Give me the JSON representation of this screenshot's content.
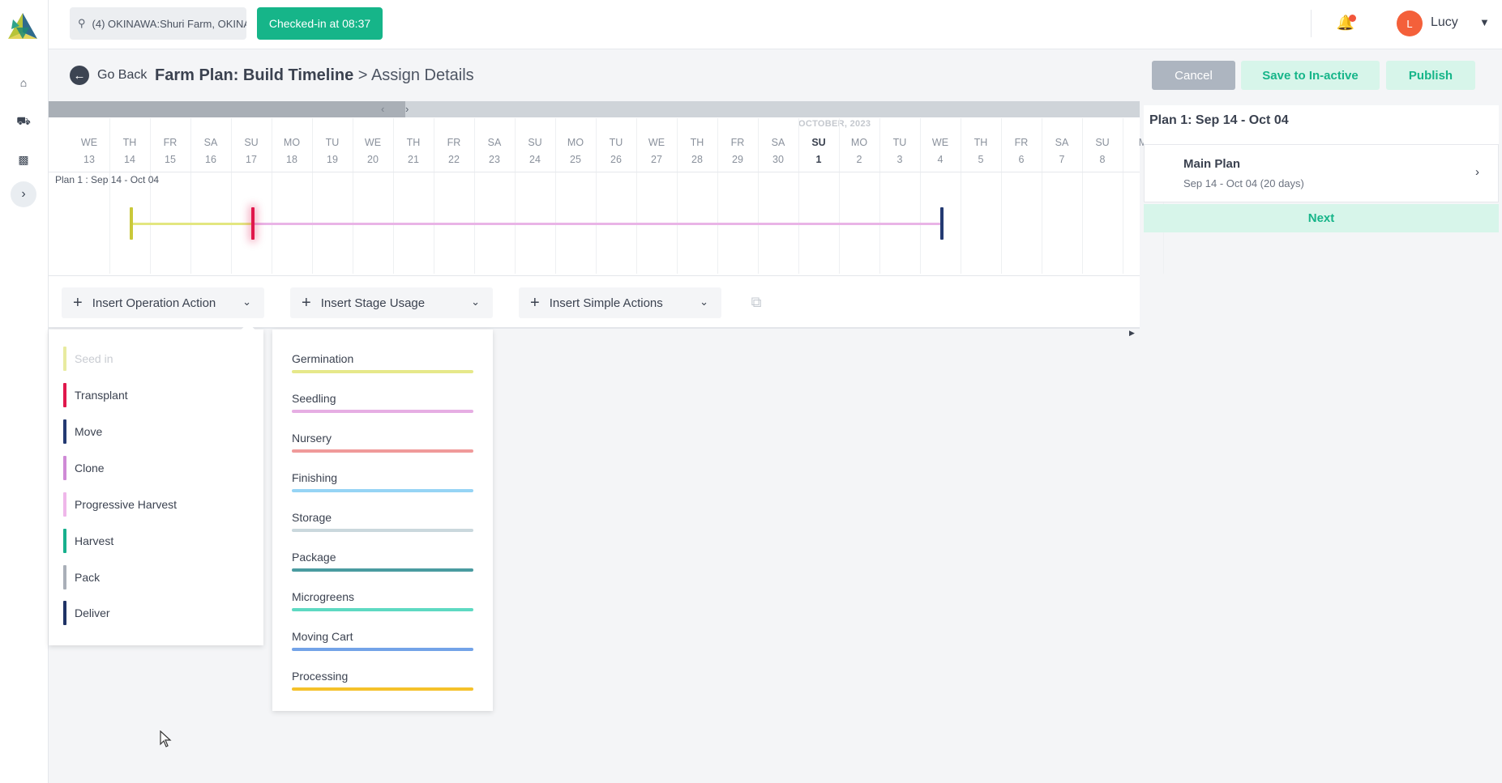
{
  "header": {
    "location": "(4) OKINAWA:Shuri Farm, OKINAWA",
    "checkin": "Checked-in at 08:37",
    "user_initial": "L",
    "user_name": "Lucy"
  },
  "page": {
    "go_back": "Go Back",
    "title": "Farm Plan: Build Timeline",
    "separator": ">",
    "subtitle": "Assign Details",
    "cancel": "Cancel",
    "save_inactive": "Save to In-active",
    "publish": "Publish"
  },
  "timeline": {
    "month": "OCTOBER, 2023",
    "row_label": "Plan 1 : Sep 14 - Oct 04",
    "days": [
      {
        "dow": "WE",
        "num": "13"
      },
      {
        "dow": "TH",
        "num": "14"
      },
      {
        "dow": "FR",
        "num": "15"
      },
      {
        "dow": "SA",
        "num": "16"
      },
      {
        "dow": "SU",
        "num": "17"
      },
      {
        "dow": "MO",
        "num": "18"
      },
      {
        "dow": "TU",
        "num": "19"
      },
      {
        "dow": "WE",
        "num": "20"
      },
      {
        "dow": "TH",
        "num": "21"
      },
      {
        "dow": "FR",
        "num": "22"
      },
      {
        "dow": "SA",
        "num": "23"
      },
      {
        "dow": "SU",
        "num": "24"
      },
      {
        "dow": "MO",
        "num": "25"
      },
      {
        "dow": "TU",
        "num": "26"
      },
      {
        "dow": "WE",
        "num": "27"
      },
      {
        "dow": "TH",
        "num": "28"
      },
      {
        "dow": "FR",
        "num": "29"
      },
      {
        "dow": "SA",
        "num": "30"
      },
      {
        "dow": "SU",
        "num": "1",
        "today": true
      },
      {
        "dow": "MO",
        "num": "2"
      },
      {
        "dow": "TU",
        "num": "3"
      },
      {
        "dow": "WE",
        "num": "4"
      },
      {
        "dow": "TH",
        "num": "5"
      },
      {
        "dow": "FR",
        "num": "6"
      },
      {
        "dow": "SA",
        "num": "7"
      },
      {
        "dow": "SU",
        "num": "8"
      },
      {
        "dow": "M",
        "num": ""
      }
    ],
    "colors": {
      "seed_segment": "#e3e680",
      "stage_segment": "#e9b4e6",
      "transplant": "#e0184c",
      "deliver": "#243a72"
    }
  },
  "actions": {
    "operation": "Insert Operation Action",
    "stage": "Insert Stage Usage",
    "simple": "Insert Simple Actions"
  },
  "operation_menu": [
    {
      "label": "Seed in",
      "color": "#e8eba0",
      "disabled": true
    },
    {
      "label": "Transplant",
      "color": "#e0184c"
    },
    {
      "label": "Move",
      "color": "#243a72"
    },
    {
      "label": "Clone",
      "color": "#cf8ad6"
    },
    {
      "label": "Progressive Harvest",
      "color": "#efb7ea"
    },
    {
      "label": "Harvest",
      "color": "#17b08d"
    },
    {
      "label": "Pack",
      "color": "#a9afb8"
    },
    {
      "label": "Deliver",
      "color": "#1f3366"
    }
  ],
  "stage_menu": [
    {
      "label": "Germination",
      "color": "#e6e88a"
    },
    {
      "label": "Seedling",
      "color": "#e6aee3"
    },
    {
      "label": "Nursery",
      "color": "#f09a9a"
    },
    {
      "label": "Finishing",
      "color": "#96d4f5"
    },
    {
      "label": "Storage",
      "color": "#cad8dd"
    },
    {
      "label": "Package",
      "color": "#4a9ba0"
    },
    {
      "label": "Microgreens",
      "color": "#5ed9c2"
    },
    {
      "label": "Moving Cart",
      "color": "#73a3e8"
    },
    {
      "label": "Processing",
      "color": "#f5c12a"
    }
  ],
  "plan_panel": {
    "title": "Plan 1: Sep 14 - Oct 04",
    "main_plan": "Main Plan",
    "main_dates": "Sep 14 - Oct 04 (20 days)",
    "next": "Next"
  }
}
